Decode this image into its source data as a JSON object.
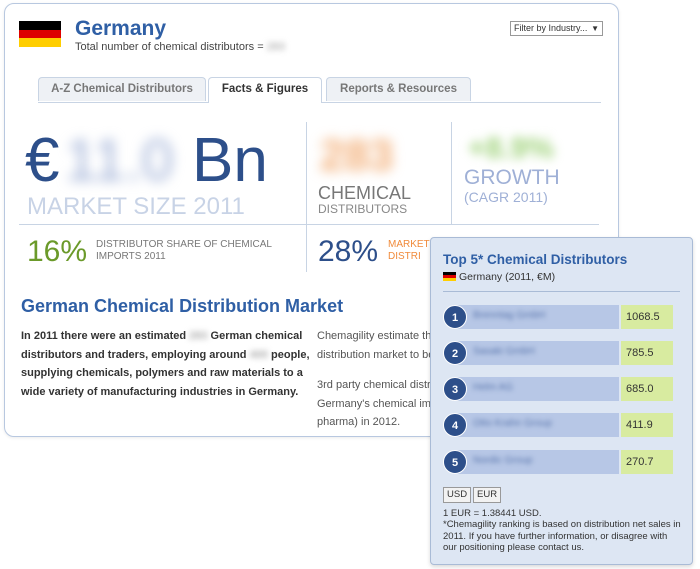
{
  "country": {
    "name": "Germany",
    "flag_colors": [
      "#000000",
      "#dd0000",
      "#ffce00"
    ],
    "subtitle_prefix": "Total number of chemical distributors = ",
    "subtitle_value": "283"
  },
  "filter": {
    "label": "Filter by Industry...",
    "arrow": "▼"
  },
  "tabs": [
    {
      "label": "A-Z Chemical Distributors",
      "active": false
    },
    {
      "label": "Facts & Figures",
      "active": true
    },
    {
      "label": "Reports & Resources",
      "active": false
    }
  ],
  "stats": {
    "market_symbol": "€",
    "market_value": "11.0",
    "market_unit": "Bn",
    "market_label": "MARKET SIZE 2011",
    "distributors_value": "283",
    "distributors_label": "CHEMICAL",
    "distributors_sub": "DISTRIBUTORS",
    "growth_value": "+8.9%",
    "growth_label": "GROWTH",
    "growth_sub": "(CAGR 2011)",
    "share_value": "16%",
    "share_label": "DISTRIBUTOR SHARE OF CHEMICAL IMPORTS 2011",
    "market_pct_value": "28%",
    "market_pct_label": "MARKET",
    "market_pct_label2": "DISTRI"
  },
  "section": {
    "title": "German Chemical Distribution Market",
    "left_p1": "In 2011 there were an estimated ",
    "left_blur1": "283",
    "left_p2": " German chemical distributors and traders, employing around ",
    "left_blur2": "400",
    "left_p3": " people, supplying chemicals, polymers and raw materials to a wide variety of manufacturing industries in Germany.",
    "right_lines1": [
      "Chemagility estimate the",
      "distribution market to be"
    ],
    "right_lines2": [
      "3rd party chemical distri",
      "Germany's chemical imp",
      "pharma) in 2012."
    ]
  },
  "panel": {
    "title": "Top 5* Chemical Distributors",
    "subtitle": "Germany (2011, €M)",
    "rows": [
      {
        "rank": "1",
        "name": "Brenntag GmbH",
        "value": "1068.5"
      },
      {
        "rank": "2",
        "name": "Sasaki GmbH",
        "value": "785.5"
      },
      {
        "rank": "3",
        "name": "Helm AG",
        "value": "685.0"
      },
      {
        "rank": "4",
        "name": "Otto Krahn Group",
        "value": "411.9"
      },
      {
        "rank": "5",
        "name": "Nordic Group",
        "value": "270.7"
      }
    ],
    "currency_buttons": [
      "USD",
      "EUR"
    ],
    "rate": "1 EUR = 1.38441 USD.",
    "note": "*Chemagility ranking is based on distribution net sales in 2011. If you have further information, or disagree with our positioning please contact us."
  }
}
